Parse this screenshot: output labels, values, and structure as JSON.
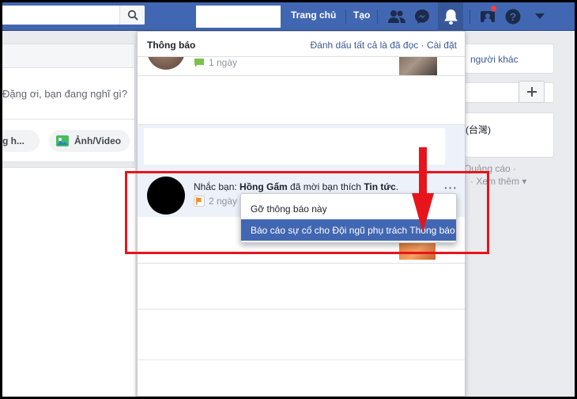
{
  "topbar": {
    "home_label": "Trang chủ",
    "create_label": "Tạo",
    "icons": [
      "search-icon",
      "friends-icon",
      "messenger-icon",
      "bell-icon",
      "groups-icon",
      "help-icon",
      "caret-down-icon"
    ]
  },
  "left": {
    "whats_on_mind": "Đặng ơi, bạn đang nghĩ gì?",
    "pill1": "g h...",
    "pill2": "Ảnh/Video"
  },
  "right": {
    "box1": "người khác",
    "box3": "(台灣)",
    "links1": "Quảng cáo ·",
    "links2": "· Xem thêm ▾"
  },
  "notifications": {
    "header": {
      "title": "Thông báo",
      "mark_all_read": "Đánh dấu tất cả là đã đọc",
      "separator": "·",
      "settings": "Cài đặt"
    },
    "first_time": "1 ngày",
    "main": {
      "prefix": "Nhắc bạn: ",
      "name": "Hồng Gấm",
      "middle": " đã mời bạn thích ",
      "page": "Tin tức",
      "suffix": ".",
      "time": "2 ngày",
      "more": "···"
    },
    "context_menu": {
      "hide": "Gỡ thông báo này",
      "report": "Báo cáo sự cố cho Đội ngũ phụ trách Thông báo"
    }
  },
  "colors": {
    "brand_blue": "#4267b2",
    "annotation_red": "#e8141c",
    "link_blue": "#385898"
  }
}
